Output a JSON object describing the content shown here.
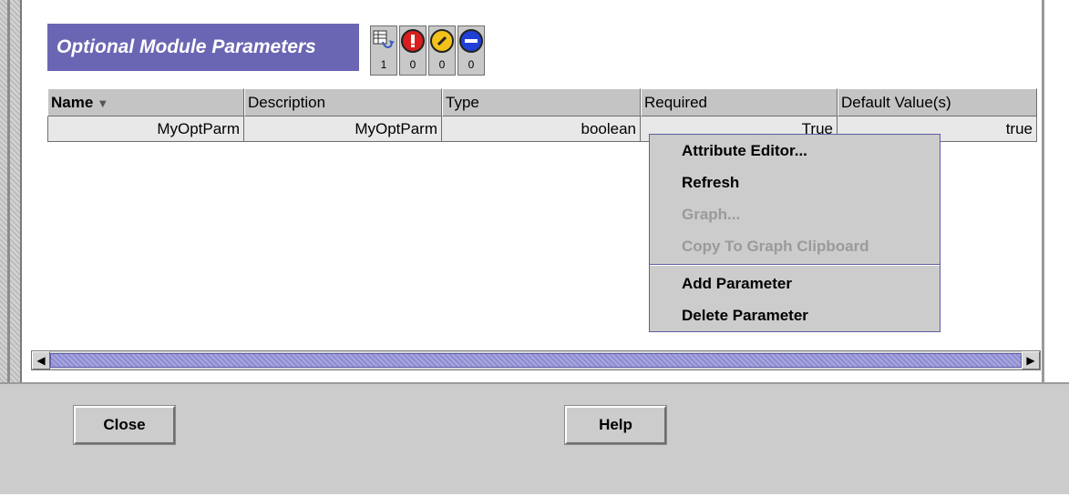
{
  "panel": {
    "title": "Optional Module Parameters"
  },
  "status_counts": [
    {
      "icon": "table-refresh-icon",
      "count": "1"
    },
    {
      "icon": "error-icon",
      "count": "0",
      "color": "#d81e1e"
    },
    {
      "icon": "warning-icon",
      "count": "0",
      "color": "#f2c21b"
    },
    {
      "icon": "info-icon",
      "count": "0",
      "color": "#1f3fd6"
    }
  ],
  "table": {
    "columns": [
      "Name",
      "Description",
      "Type",
      "Required",
      "Default Value(s)"
    ],
    "sorted_column": "Name",
    "rows": [
      [
        "MyOptParm",
        "MyOptParm",
        "boolean",
        "True",
        "true"
      ]
    ]
  },
  "context_menu": {
    "items": [
      {
        "label": "Attribute Editor...",
        "enabled": true
      },
      {
        "label": "Refresh",
        "enabled": true
      },
      {
        "label": "Graph...",
        "enabled": false
      },
      {
        "label": "Copy To Graph Clipboard",
        "enabled": false
      },
      {
        "label": "Add Parameter",
        "enabled": true
      },
      {
        "label": "Delete Parameter",
        "enabled": true
      }
    ]
  },
  "buttons": {
    "close": "Close",
    "help": "Help"
  },
  "colors": {
    "title_bg": "#6b66b3",
    "accent": "#5f5da6",
    "panel_bg": "#cccccc"
  }
}
